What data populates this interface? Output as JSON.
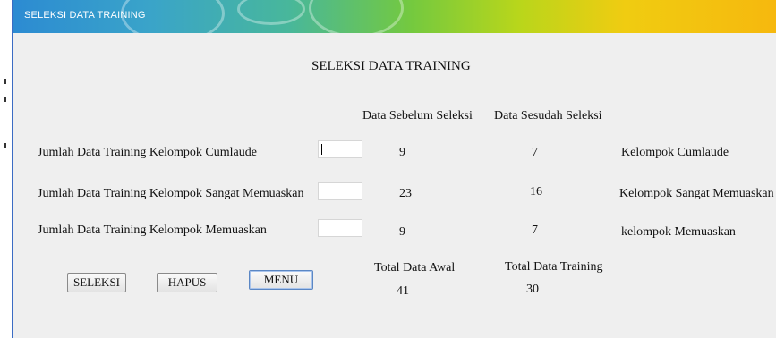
{
  "window": {
    "title": "SELEKSI DATA TRAINING"
  },
  "heading": "SELEKSI DATA TRAINING",
  "columns": {
    "before": "Data Sebelum Seleksi",
    "after": "Data Sesudah Seleksi"
  },
  "rows": [
    {
      "label": "Jumlah Data Training Kelompok Cumlaude",
      "input_value": "",
      "before": "9",
      "after": "7",
      "group": "Kelompok Cumlaude"
    },
    {
      "label": "Jumlah Data Training Kelompok Sangat Memuaskan",
      "input_value": "",
      "before": "23",
      "after": "16",
      "group": "Kelompok Sangat Memuaskan"
    },
    {
      "label": "Jumlah Data Training Kelompok Memuaskan",
      "input_value": "",
      "before": "9",
      "after": "7",
      "group": "kelompok Memuaskan"
    }
  ],
  "totals": {
    "awal_label": "Total Data Awal",
    "awal_value": "41",
    "training_label": "Total Data Training",
    "training_value": "30"
  },
  "buttons": {
    "seleksi": "SELEKSI",
    "hapus": "HAPUS",
    "menu": "MENU"
  }
}
